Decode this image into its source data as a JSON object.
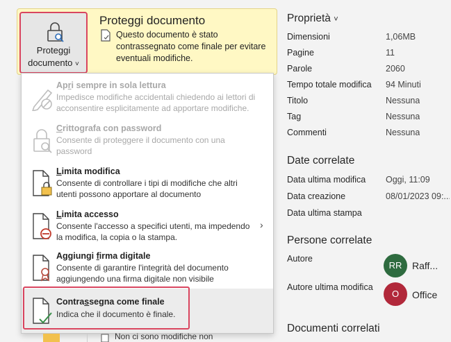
{
  "protect_button": {
    "line1": "Proteggi",
    "line2": "documento",
    "chevron": "˅"
  },
  "card": {
    "title": "Proteggi documento",
    "description": "Questo documento è stato contrassegnato come finale per evitare eventuali modifiche."
  },
  "menu": {
    "items": [
      {
        "title_pre": "Ap",
        "title_ul": "r",
        "title_post": "i sempre in sola lettura",
        "desc": "Impedisce modifiche accidentali chiedendo ai lettori di acconsentire esplicitamente ad apportare modifiche.",
        "enabled": false,
        "icon": "pencil-disabled-icon"
      },
      {
        "title_pre": "",
        "title_ul": "C",
        "title_post": "rittografa con password",
        "desc": "Consente di proteggere il documento con una password",
        "enabled": false,
        "icon": "lock-search-icon"
      },
      {
        "title_pre": "",
        "title_ul": "L",
        "title_post": "imita modifica",
        "desc": "Consente di controllare i tipi di modifiche che altri utenti possono apportare al documento",
        "enabled": true,
        "icon": "document-lock-icon"
      },
      {
        "title_pre": "",
        "title_ul": "L",
        "title_post": "imita accesso",
        "desc": "Consente l'accesso a specifici utenti, ma impedendo la modifica, la copia o la stampa.",
        "enabled": true,
        "icon": "document-restrict-icon",
        "submenu": "›"
      },
      {
        "title_pre": "Aggiungi ",
        "title_ul": "f",
        "title_post": "irma digitale",
        "desc": "Consente di garantire l'integrità del documento aggiungendo una firma digitale non visibile",
        "enabled": true,
        "icon": "document-ribbon-icon"
      },
      {
        "title_pre": "Contra",
        "title_ul": "s",
        "title_post": "segna come finale",
        "desc": "Indica che il documento è finale.",
        "enabled": true,
        "icon": "document-check-icon"
      }
    ]
  },
  "bottom_text": "Non ci sono modifiche non",
  "properties": {
    "header": "Proprietà",
    "chevron": "˅",
    "rows": [
      {
        "key": "Dimensioni",
        "value": "1,06MB"
      },
      {
        "key": "Pagine",
        "value": "11"
      },
      {
        "key": "Parole",
        "value": "2060"
      },
      {
        "key": "Tempo totale modifica",
        "value": "94 Minuti"
      },
      {
        "key": "Titolo",
        "value": "Nessuna"
      },
      {
        "key": "Tag",
        "value": "Nessuna"
      },
      {
        "key": "Commenti",
        "value": "Nessuna"
      }
    ]
  },
  "dates": {
    "header": "Date correlate",
    "rows": [
      {
        "key": "Data ultima modifica",
        "value": "Oggi, 11:09"
      },
      {
        "key": "Data creazione",
        "value": "08/01/2023 09:..."
      },
      {
        "key": "Data ultima stampa",
        "value": ""
      }
    ]
  },
  "people": {
    "header": "Persone correlate",
    "author_label": "Autore",
    "author_initials": "RR",
    "author_name": "Raff...",
    "last_editor_label": "Autore ultima modifica",
    "last_editor_initials": "O",
    "last_editor_name": "Office"
  },
  "related_docs": {
    "header": "Documenti correlati"
  },
  "colors": {
    "accent_red": "#d9455f",
    "card_bg": "#fff8c4",
    "avatar_green": "#2e6b3f",
    "avatar_red": "#b1283a"
  }
}
